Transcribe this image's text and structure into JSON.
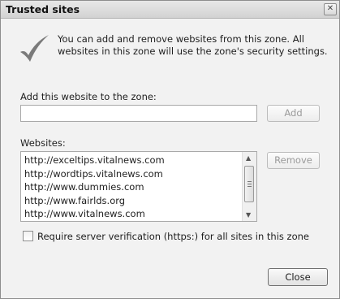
{
  "dialog": {
    "title": "Trusted sites",
    "close_glyph": "✕",
    "description": "You can add and remove websites from this zone. All websites in this zone will use the zone's security settings.",
    "add_label": "Add this website to the zone:",
    "add_value": "",
    "add_button": "Add",
    "websites_label": "Websites:",
    "websites": [
      "http://exceltips.vitalnews.com",
      "http://wordtips.vitalnews.com",
      "http://www.dummies.com",
      "http://www.fairlds.org",
      "http://www.vitalnews.com"
    ],
    "remove_button": "Remove",
    "require_verification_label": "Require server verification (https:) for all sites in this zone",
    "require_verification_checked": false,
    "close_button": "Close",
    "scroll_up": "▲",
    "scroll_down": "▼",
    "check_icon_color": "#7a7a7a"
  }
}
